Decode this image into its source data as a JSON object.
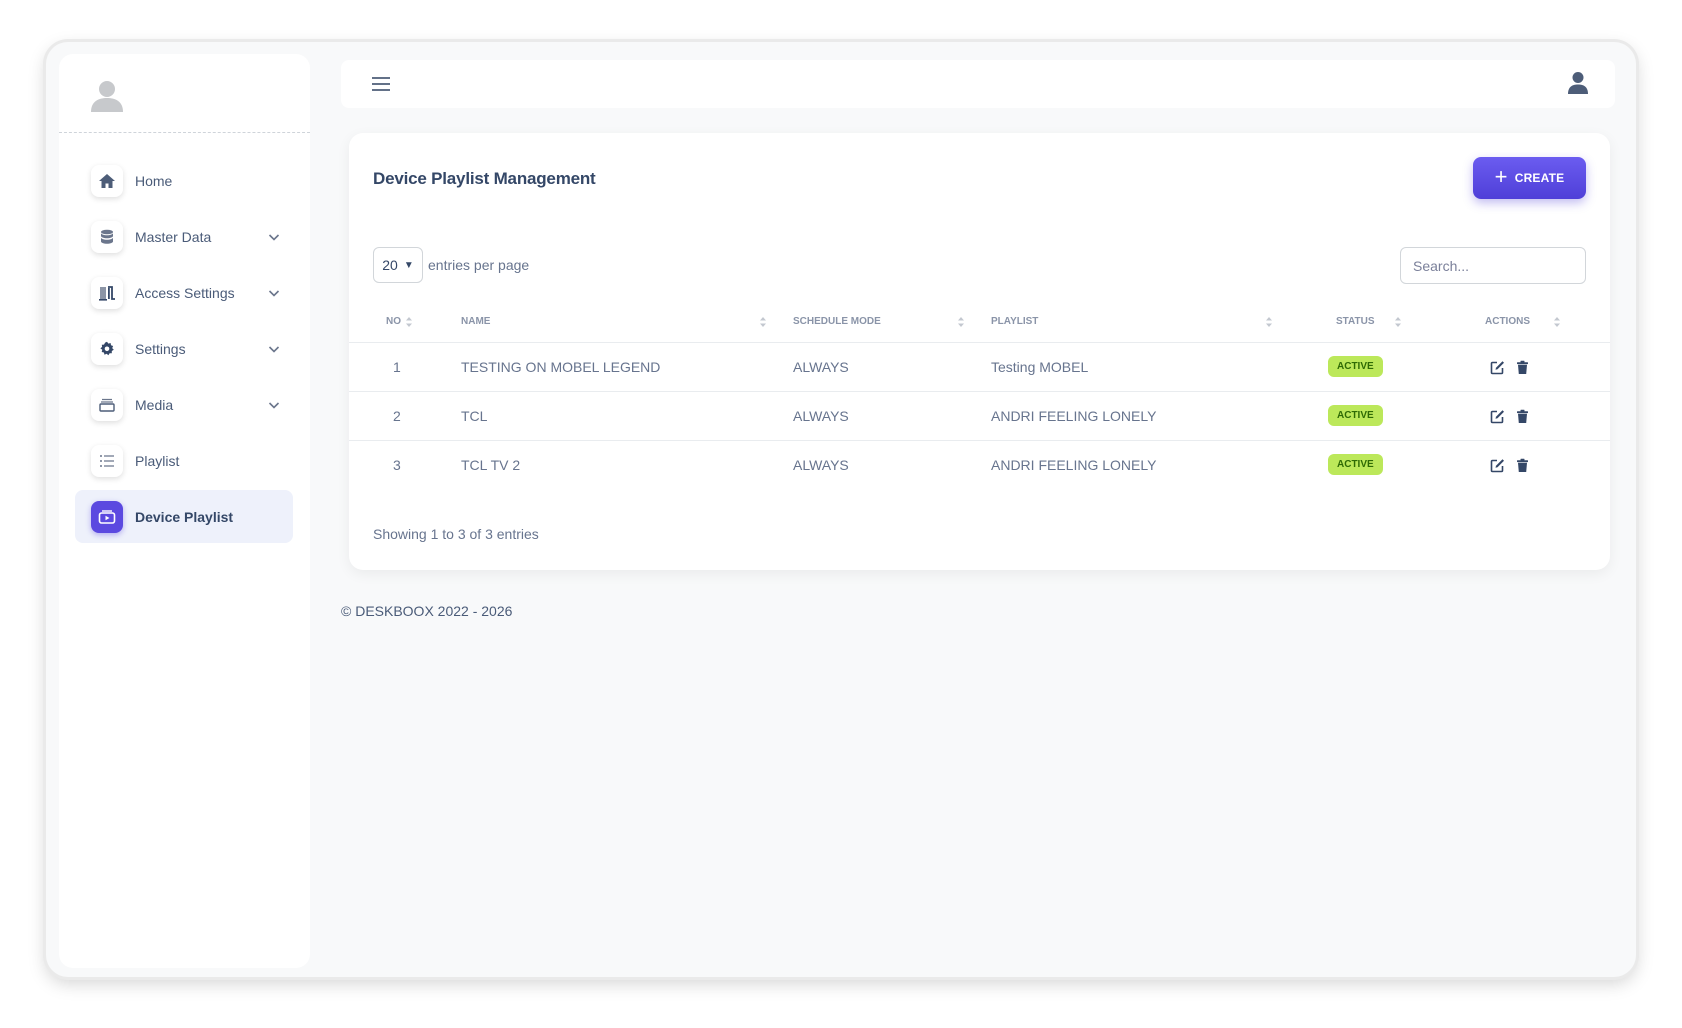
{
  "sidebar": {
    "items": [
      {
        "label": "Home",
        "icon": "home-icon",
        "expandable": false,
        "active": false
      },
      {
        "label": "Master Data",
        "icon": "database-icon",
        "expandable": true,
        "active": false
      },
      {
        "label": "Access Settings",
        "icon": "building-icon",
        "expandable": true,
        "active": false
      },
      {
        "label": "Settings",
        "icon": "gear-icon",
        "expandable": true,
        "active": false
      },
      {
        "label": "Media",
        "icon": "folder-icon",
        "expandable": true,
        "active": false
      },
      {
        "label": "Playlist",
        "icon": "list-icon",
        "expandable": false,
        "active": false
      },
      {
        "label": "Device Playlist",
        "icon": "device-playlist-icon",
        "expandable": false,
        "active": true
      }
    ]
  },
  "main": {
    "title": "Device Playlist Management",
    "create_label": "CREATE",
    "entries": {
      "value": "20",
      "suffix": "entries per page"
    },
    "search": {
      "placeholder": "Search..."
    },
    "table": {
      "columns": [
        "No",
        "Name",
        "Schedule Mode",
        "Playlist",
        "Status",
        "Actions"
      ],
      "rows": [
        {
          "no": "1",
          "name": "TESTING ON MOBEL LEGEND",
          "schedule": "ALWAYS",
          "playlist": "Testing MOBEL",
          "status": "ACTIVE"
        },
        {
          "no": "2",
          "name": "TCL",
          "schedule": "ALWAYS",
          "playlist": "ANDRI FEELING LONELY",
          "status": "ACTIVE"
        },
        {
          "no": "3",
          "name": "TCL TV 2",
          "schedule": "ALWAYS",
          "playlist": "ANDRI FEELING LONELY",
          "status": "ACTIVE"
        }
      ]
    },
    "showing": "Showing 1 to 3 of 3 entries"
  },
  "footer": {
    "text": "© DESKBOOX 2022 - 2026"
  },
  "colors": {
    "accent": "#5b49e0",
    "badge_bg": "#bce85a",
    "badge_text": "#2f6b05",
    "text_dark": "#344767"
  }
}
